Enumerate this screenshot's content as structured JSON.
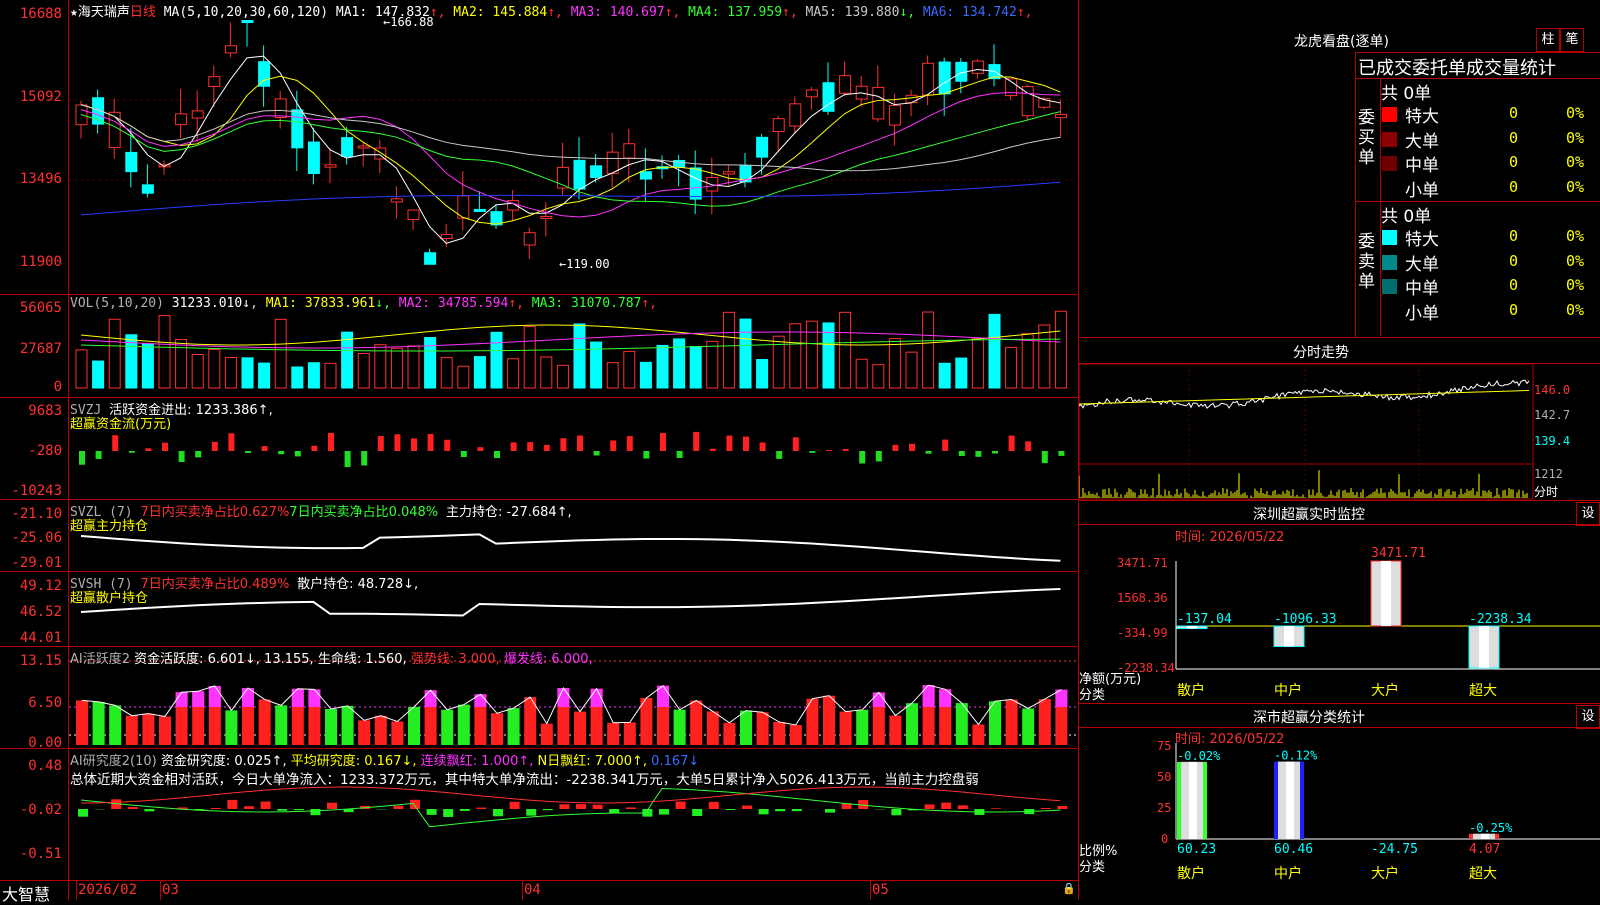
{
  "stock": {
    "name": "海天瑞声",
    "period": "日线",
    "ma_label": "MA(5,10,20,30,60,120)",
    "ma": [
      {
        "label": "MA1:",
        "value": "147.832",
        "arrow": "↑",
        "color": "#ffffff"
      },
      {
        "label": "MA2:",
        "value": "145.884",
        "arrow": "↑",
        "color": "#ffff00"
      },
      {
        "label": "MA3:",
        "value": "140.697",
        "arrow": "↑",
        "color": "#ff33ff"
      },
      {
        "label": "MA4:",
        "value": "137.959",
        "arrow": "↑",
        "color": "#33ff33"
      },
      {
        "label": "MA5:",
        "value": "139.880",
        "arrow": "↓",
        "color": "#c8c8c8"
      },
      {
        "label": "MA6:",
        "value": "134.742",
        "arrow": "↑",
        "color": "#3a6bff"
      }
    ],
    "price_axis": [
      "16688",
      "15092",
      "13496",
      "11900"
    ],
    "high_mark": "166.88",
    "low_mark": "119.00"
  },
  "vol": {
    "label": "VOL(5,10,20)",
    "value": "31233.010",
    "arrow": "↓",
    "ma": [
      {
        "label": "MA1:",
        "value": "37833.961",
        "arrow": "↓",
        "color": "#ffff00"
      },
      {
        "label": "MA2:",
        "value": "34785.594",
        "arrow": "↑",
        "color": "#ff33ff"
      },
      {
        "label": "MA3:",
        "value": "31070.787",
        "arrow": "↑",
        "color": "#33ff33"
      }
    ],
    "axis": [
      "56065",
      "27687",
      "0"
    ]
  },
  "svzj": {
    "label": "SVZJ",
    "text": "活跃资金进出: 1233.386↑,",
    "sub": "超赢资金流(万元)",
    "axis": [
      "9683",
      "-280",
      "-10243"
    ]
  },
  "svzl": {
    "label": "SVZL (7)",
    "red_text": "7日内买卖净占比0.627%",
    "green_text": "7日内买卖净占比0.048%",
    "white_text": "主力持仓: -27.684↑,",
    "sub": "超赢主力持仓",
    "axis": [
      "-21.10",
      "-25.06",
      "-29.01"
    ]
  },
  "svsh": {
    "label": "SVSH (7)",
    "red_text": "7日内买卖净占比0.489%",
    "white_text": "散户持仓: 48.728↓,",
    "sub": "超赢散户持仓",
    "axis": [
      "49.12",
      "46.52",
      "44.01"
    ]
  },
  "ai_active": {
    "label": "AI活跃度2",
    "t1": "资金活跃度: 6.601↓,",
    "t2": "13.155,",
    "t3": "生命线: 1.560,",
    "t4": "强势线: 3.000,",
    "t5": "爆发线: 6.000,",
    "axis": [
      "13.15",
      "6.50",
      "0.00"
    ]
  },
  "ai_research": {
    "label": "AI研究度2(10)",
    "t1": "资金研究度: 0.025↑,",
    "t2": "平均研究度: 0.167↓,",
    "t3": "连续飘红: 1.000↑,",
    "t4": "N日飘红: 7.000↑,",
    "t5": "0.167↓",
    "summary": "总体近期大资金相对活跃，今日大单净流入：1233.372万元，其中特大单净流出：-2238.341万元，大单5日累计净入5026.413万元，当前主力控盘弱",
    "axis": [
      "0.48",
      "-0.02",
      "-0.51"
    ]
  },
  "bottom_bar": {
    "brand": "大智慧",
    "dates": [
      "2026/02",
      "03",
      "04",
      "05"
    ]
  },
  "right": {
    "title": "龙虎看盘(逐单)",
    "btn_zhu": "柱",
    "btn_bi": "笔",
    "subtitle": "已成交委托单成交量统计",
    "buy": {
      "side": "委买单",
      "total": "共 0单",
      "rows": [
        {
          "name": "特大",
          "a": "0",
          "b": "0%",
          "color": "#ff0000"
        },
        {
          "name": "大单",
          "a": "0",
          "b": "0%",
          "color": "#8b0000"
        },
        {
          "name": "中单",
          "a": "0",
          "b": "0%",
          "color": "#6e0000"
        },
        {
          "name": "小单",
          "a": "0",
          "b": "0%",
          "color": "#000000"
        }
      ]
    },
    "sell": {
      "side": "委卖单",
      "total": "共 0单",
      "rows": [
        {
          "name": "特大",
          "a": "0",
          "b": "0%",
          "color": "#00ffff"
        },
        {
          "name": "大单",
          "a": "0",
          "b": "0%",
          "color": "#008b8b"
        },
        {
          "name": "中单",
          "a": "0",
          "b": "0%",
          "color": "#006e6e"
        },
        {
          "name": "小单",
          "a": "0",
          "b": "0%",
          "color": "#000000"
        }
      ]
    },
    "intraday": {
      "title": "分时走势",
      "axis": [
        "146.0",
        "142.7",
        "139.4",
        "1212",
        "分时"
      ]
    },
    "monitor": {
      "title": "深圳超赢实时监控",
      "btn": "设",
      "time": "时间: 2026/05/22",
      "axis": [
        "3471.71",
        "1568.36",
        "-334.99",
        "-2238.34"
      ],
      "ylabel": "净额(万元)",
      "xlabel": "分类",
      "cats": [
        "散户",
        "中户",
        "大户",
        "超大"
      ],
      "values": [
        "-137.04",
        "-1096.33",
        "3471.71",
        "-2238.34"
      ]
    },
    "classify": {
      "title": "深市超赢分类统计",
      "btn": "设",
      "time": "时间: 2026/05/22",
      "axis": [
        "75",
        "50",
        "25",
        "0"
      ],
      "ylabel": "比例%",
      "xlabel": "分类",
      "cats": [
        "散户",
        "中户",
        "大户",
        "超大"
      ],
      "top": [
        "-0.02%",
        "-0.12%",
        "",
        "-0.25%"
      ],
      "bottom": [
        "60.23",
        "60.46",
        "-24.75",
        "4.07"
      ]
    }
  }
}
